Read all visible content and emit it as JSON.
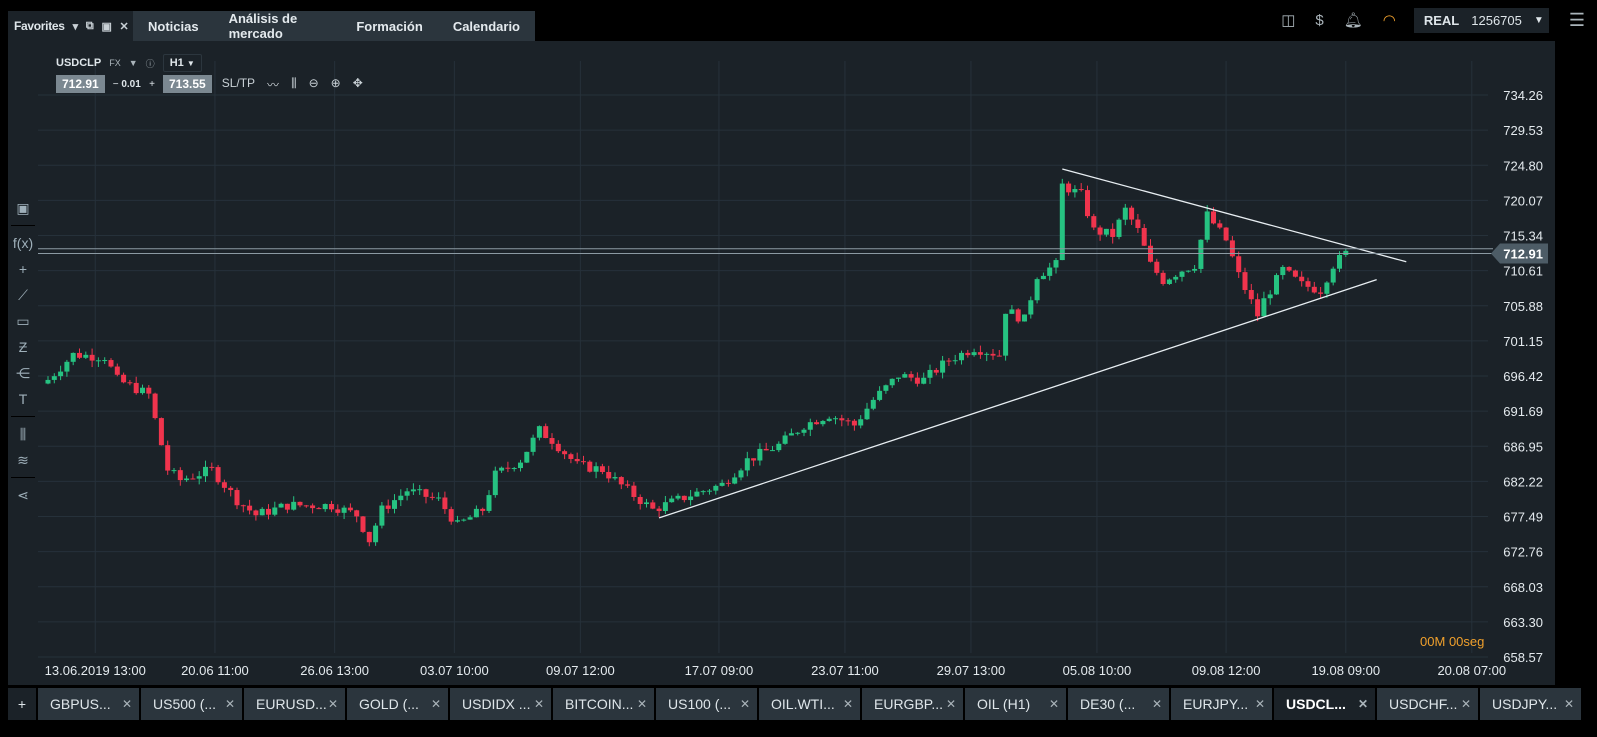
{
  "topnav": {
    "favorites": "Favorites",
    "tabs": [
      "Noticias",
      "Análisis de mercado",
      "Formación",
      "Calendario"
    ]
  },
  "account": {
    "mode": "REAL",
    "number": "1256705"
  },
  "instrument": {
    "symbol": "USDCLP",
    "type": "FX",
    "timeframe": "H1",
    "sell": "712.91",
    "spread": "0.01",
    "buy": "713.55",
    "sltp": "SL/TP"
  },
  "timer": {
    "min": "00",
    "min_unit": "M",
    "sec": "00",
    "sec_unit": "seg"
  },
  "bottom_tabs": [
    "GBPUS...",
    "US500 (...",
    "EURUSD...",
    "GOLD (...",
    "USDIDX ...",
    "BITCOIN...",
    "US100 (...",
    "OIL.WTI...",
    "EURGBP...",
    "OIL (H1)",
    "DE30 (...",
    "EURJPY...",
    "USDCL...",
    "USDCHF...",
    "USDJPY..."
  ],
  "active_tab": 12,
  "colors": {
    "up": "#26c281",
    "down": "#f0344d",
    "bg": "#1b2228",
    "grid": "#26313a",
    "accent": "#f0a02c"
  },
  "chart_data": {
    "type": "candlestick",
    "ylim": [
      658.57,
      734.26
    ],
    "y_ticks": [
      "734.26",
      "729.53",
      "724.80",
      "720.07",
      "715.34",
      "710.61",
      "705.88",
      "701.15",
      "696.42",
      "691.69",
      "686.95",
      "682.22",
      "677.49",
      "672.76",
      "668.03",
      "663.30",
      "658.57"
    ],
    "x_ticks": [
      {
        "label": "13.06.2019 13:00",
        "i": 7.5
      },
      {
        "label": "20.06 11:00",
        "i": 26.5
      },
      {
        "label": "26.06 13:00",
        "i": 45.5
      },
      {
        "label": "03.07 10:00",
        "i": 64.5
      },
      {
        "label": "09.07 12:00",
        "i": 84.5
      },
      {
        "label": "17.07 09:00",
        "i": 106.5
      },
      {
        "label": "23.07 11:00",
        "i": 126.5
      },
      {
        "label": "29.07 13:00",
        "i": 146.5
      },
      {
        "label": "05.08 10:00",
        "i": 166.5
      },
      {
        "label": "09.08 12:00",
        "i": 187
      },
      {
        "label": "19.08 09:00",
        "i": 206
      },
      {
        "label": "20.08 07:00",
        "i": 226
      }
    ],
    "close_keypoints": [
      [
        0,
        695.9
      ],
      [
        4,
        699.3
      ],
      [
        9,
        699
      ],
      [
        11,
        695.9
      ],
      [
        16,
        693.9
      ],
      [
        19,
        683.8
      ],
      [
        21,
        682.4
      ],
      [
        26,
        683.8
      ],
      [
        30,
        679.7
      ],
      [
        33,
        677.7
      ],
      [
        38,
        679
      ],
      [
        45,
        679
      ],
      [
        49,
        677.7
      ],
      [
        51,
        674.3
      ],
      [
        53,
        678.4
      ],
      [
        57,
        681
      ],
      [
        62,
        679.7
      ],
      [
        65,
        676.3
      ],
      [
        69,
        678.4
      ],
      [
        71,
        683.1
      ],
      [
        75,
        685.1
      ],
      [
        78,
        689.1
      ],
      [
        80,
        687.8
      ],
      [
        84,
        684.4
      ],
      [
        88,
        683.8
      ],
      [
        92,
        681
      ],
      [
        96,
        678.4
      ],
      [
        102,
        680.4
      ],
      [
        107,
        681.8
      ],
      [
        111,
        685.1
      ],
      [
        116,
        687.1
      ],
      [
        120,
        689.8
      ],
      [
        124,
        691.2
      ],
      [
        128,
        689.8
      ],
      [
        131,
        693.2
      ],
      [
        135,
        696.5
      ],
      [
        139,
        695.9
      ],
      [
        143,
        698.6
      ],
      [
        147,
        700.2
      ],
      [
        151,
        699.3
      ],
      [
        152,
        705.3
      ],
      [
        155,
        704
      ],
      [
        157,
        710
      ],
      [
        160,
        711.4
      ],
      [
        161,
        722.1
      ],
      [
        164,
        720.8
      ],
      [
        166,
        716
      ],
      [
        169,
        715.4
      ],
      [
        171,
        718.8
      ],
      [
        173,
        716
      ],
      [
        175,
        711.4
      ],
      [
        177,
        709.3
      ],
      [
        180,
        710.7
      ],
      [
        182,
        711.4
      ],
      [
        184,
        718.1
      ],
      [
        187,
        714.7
      ],
      [
        189,
        710
      ],
      [
        192,
        704.6
      ],
      [
        193,
        706.6
      ],
      [
        196,
        710.7
      ],
      [
        199,
        708.7
      ],
      [
        202,
        708
      ],
      [
        204,
        711.4
      ],
      [
        206,
        712.9
      ]
    ],
    "trendlines": [
      {
        "from": [
          161,
          724.3
        ],
        "to": [
          215.6,
          711.8
        ]
      },
      {
        "from": [
          97,
          677.3
        ],
        "to": [
          210.9,
          709.4
        ]
      }
    ],
    "bid": 712.91,
    "ask": 713.55,
    "bid_label": "712.91"
  }
}
